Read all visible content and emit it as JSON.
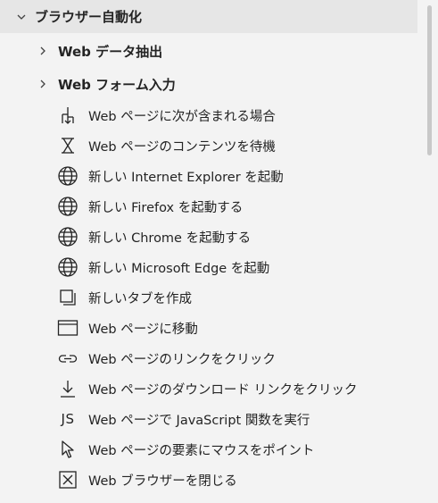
{
  "group": {
    "label": "ブラウザー自動化",
    "icon": "chevron-down-icon"
  },
  "subgroups": [
    {
      "label": "Web データ抽出",
      "icon": "chevron-right-icon"
    },
    {
      "label": "Web フォーム入力",
      "icon": "chevron-right-icon"
    }
  ],
  "actions": [
    {
      "label": "Web ページに次が含まれる場合",
      "icon": "branch-icon"
    },
    {
      "label": "Web ページのコンテンツを待機",
      "icon": "hourglass-icon"
    },
    {
      "label": "新しい Internet Explorer を起動",
      "icon": "globe-icon"
    },
    {
      "label": "新しい Firefox を起動する",
      "icon": "globe-icon"
    },
    {
      "label": "新しい Chrome を起動する",
      "icon": "globe-icon"
    },
    {
      "label": "新しい Microsoft Edge を起動",
      "icon": "globe-icon"
    },
    {
      "label": "新しいタブを作成",
      "icon": "new-tab-icon"
    },
    {
      "label": "Web ページに移動",
      "icon": "browser-window-icon"
    },
    {
      "label": "Web ページのリンクをクリック",
      "icon": "link-icon"
    },
    {
      "label": "Web ページのダウンロード リンクをクリック",
      "icon": "download-icon"
    },
    {
      "label": "Web ページで JavaScript 関数を実行",
      "icon": "javascript-icon",
      "glyph": "JS"
    },
    {
      "label": "Web ページの要素にマウスをポイント",
      "icon": "cursor-icon"
    },
    {
      "label": "Web ブラウザーを閉じる",
      "icon": "close-box-icon"
    }
  ]
}
